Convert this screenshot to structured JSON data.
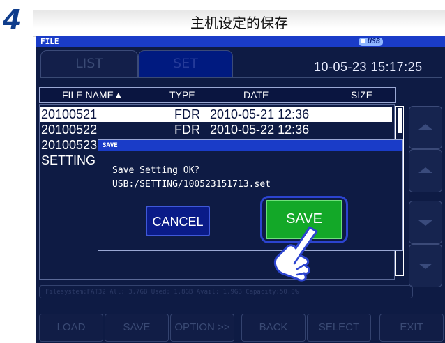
{
  "doc": {
    "step_number": "4",
    "caption": "主机设定的保存"
  },
  "window": {
    "title": "FILE",
    "media": "USB"
  },
  "tabs": [
    {
      "label": "LIST",
      "active": false
    },
    {
      "label": "SET",
      "active": true
    }
  ],
  "clock": "10-05-23 15:17:25",
  "table": {
    "columns": [
      "FILE NAME▲",
      "TYPE",
      "DATE",
      "SIZE"
    ],
    "rows": [
      {
        "name": "20100521",
        "type": "FDR",
        "date": "2010-05-21  12:36",
        "selected": true
      },
      {
        "name": "20100522",
        "type": "FDR",
        "date": "2010-05-22  12:36",
        "selected": false
      },
      {
        "name": "20100523",
        "type": "",
        "date": "",
        "selected": false
      },
      {
        "name": "SETTING",
        "type": "",
        "date": "",
        "selected": false
      }
    ]
  },
  "side_buttons": [
    "scroll-up",
    "page-up",
    "page-down",
    "scroll-down"
  ],
  "status_bar": "Filesystem:FAT32 All: 3.7GB Used: 1.8GB Avail: 1.9GB Capacity:50.0%",
  "footer_buttons": [
    "LOAD",
    "SAVE",
    "OPTION >>",
    "BACK",
    "SELECT",
    "EXIT"
  ],
  "dialog": {
    "title": "SAVE",
    "message": "Save Setting OK?",
    "path": "USB:/SETTING/100523151713.set",
    "cancel_label": "CANCEL",
    "save_label": "SAVE"
  },
  "colors": {
    "screen_bg": "#0e1b44",
    "titlebar_blue": "#1a3cc8",
    "save_green": "#13a828",
    "cancel_blue": "#0a1b88",
    "step_number": "#0f3d8c"
  },
  "icons": [
    "pointing-hand-icon",
    "usb-icon"
  ]
}
